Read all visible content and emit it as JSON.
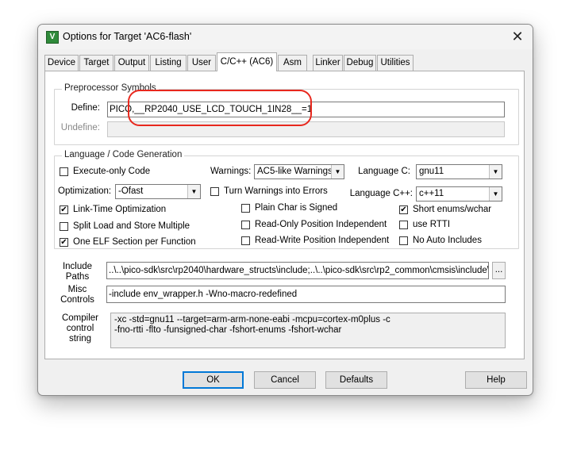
{
  "window": {
    "title": "Options for Target 'AC6-flash'",
    "app_icon": "V",
    "close_glyph": "✕"
  },
  "tabs": [
    "Device",
    "Target",
    "Output",
    "Listing",
    "User",
    "C/C++ (AC6)",
    "Asm",
    "Linker",
    "Debug",
    "Utilities"
  ],
  "active_tab": "C/C++ (AC6)",
  "preprocessor": {
    "group_label": "Preprocessor Symbols",
    "define_label": "Define:",
    "define_value": "PICO,__RP2040_USE_LCD_TOUCH_1IN28__=1",
    "undefine_label": "Undefine:",
    "undefine_value": ""
  },
  "language": {
    "group_label": "Language / Code Generation",
    "execute_only": {
      "label": "Execute-only Code",
      "checked": false
    },
    "optimization_label": "Optimization:",
    "optimization_value": "-Ofast",
    "link_time": {
      "label": "Link-Time Optimization",
      "checked": true
    },
    "split_load": {
      "label": "Split Load and Store Multiple",
      "checked": false
    },
    "one_elf": {
      "label": "One ELF Section per Function",
      "checked": true
    },
    "warnings_label": "Warnings:",
    "warnings_value": "AC5-like Warnings",
    "turn_warnings": {
      "label": "Turn Warnings into Errors",
      "checked": false
    },
    "plain_char": {
      "label": "Plain Char is Signed",
      "checked": false
    },
    "ropi": {
      "label": "Read-Only Position Independent",
      "checked": false
    },
    "rwpi": {
      "label": "Read-Write Position Independent",
      "checked": false
    },
    "language_c_label": "Language C:",
    "language_c_value": "gnu11",
    "language_cpp_label": "Language C++:",
    "language_cpp_value": "c++11",
    "short_enums": {
      "label": "Short enums/wchar",
      "checked": true
    },
    "use_rtti": {
      "label": "use RTTI",
      "checked": false
    },
    "no_auto_includes": {
      "label": "No Auto Includes",
      "checked": false
    }
  },
  "include_paths": {
    "label_line1": "Include",
    "label_line2": "Paths",
    "value": "..\\..\\pico-sdk\\src\\rp2040\\hardware_structs\\include;..\\..\\pico-sdk\\src\\rp2_common\\cmsis\\include\\cm",
    "browse_label": "..."
  },
  "misc_controls": {
    "label_line1": "Misc",
    "label_line2": "Controls",
    "value": "-include env_wrapper.h -Wno-macro-redefined"
  },
  "compiler_control": {
    "label_line1": "Compiler",
    "label_line2": "control",
    "label_line3": "string",
    "line1": "-xc -std=gnu11 --target=arm-arm-none-eabi -mcpu=cortex-m0plus -c",
    "line2": "-fno-rtti -flto -funsigned-char -fshort-enums -fshort-wchar"
  },
  "buttons": {
    "ok": "OK",
    "cancel": "Cancel",
    "defaults": "Defaults",
    "help": "Help"
  },
  "check_glyph": "✔",
  "dropdown_glyph": "▼",
  "colors": {
    "annotation": "#e8281e",
    "default_button_border": "#0078d7",
    "app_icon": "#2f8a3a"
  }
}
